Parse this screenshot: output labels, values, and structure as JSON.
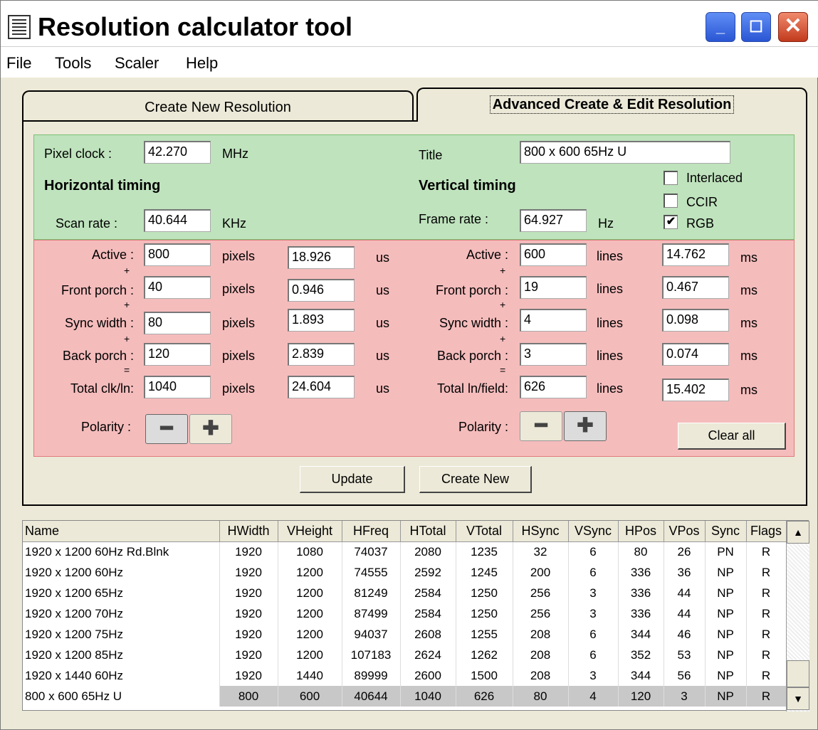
{
  "window": {
    "title": "Resolution calculator tool"
  },
  "titlebar_buttons": {
    "minimize": "_",
    "maximize": "☐",
    "close": "✕"
  },
  "menu": [
    "File",
    "Tools",
    "Scaler",
    "Help"
  ],
  "tabs": [
    {
      "label": "Create New Resolution",
      "active": false
    },
    {
      "label": "Advanced Create & Edit Resolution",
      "active": true
    }
  ],
  "form": {
    "pixel_clock_label": "Pixel clock :",
    "pixel_clock": "42.270",
    "pixel_clock_unit": "MHz",
    "title_label": "Title",
    "title_value": "800 x 600 65Hz        U",
    "horizontal_heading": "Horizontal timing",
    "vertical_heading": "Vertical timing",
    "interlaced_label": "Interlaced",
    "ccir_label": "CCIR",
    "rgb_label": "RGB",
    "interlaced": false,
    "ccir": false,
    "rgb": true,
    "scan_rate_label": "Scan rate :",
    "scan_rate": "40.644",
    "scan_rate_unit": "KHz",
    "frame_rate_label": "Frame rate :",
    "frame_rate": "64.927",
    "frame_rate_unit": "Hz",
    "h_rows": [
      {
        "label": "Active :",
        "px": "800",
        "us": "18.926"
      },
      {
        "label": "Front porch :",
        "px": "40",
        "us": "0.946"
      },
      {
        "label": "Sync width :",
        "px": "80",
        "us": "1.893"
      },
      {
        "label": "Back porch :",
        "px": "120",
        "us": "2.839"
      },
      {
        "label": "Total clk/ln:",
        "px": "1040",
        "us": "24.604"
      }
    ],
    "v_rows": [
      {
        "label": "Active :",
        "lines": "600",
        "ms": "14.762"
      },
      {
        "label": "Front porch :",
        "lines": "19",
        "ms": "0.467"
      },
      {
        "label": "Sync width :",
        "lines": "4",
        "ms": "0.098"
      },
      {
        "label": "Back porch :",
        "lines": "3",
        "ms": "0.074"
      },
      {
        "label": "Total ln/field:",
        "lines": "626",
        "ms": "15.402"
      }
    ],
    "ops": [
      "+",
      "+",
      "+",
      "="
    ],
    "px_unit": "pixels",
    "us_unit": "us",
    "lines_unit": "lines",
    "ms_unit": "ms",
    "polarity_label": "Polarity :",
    "h_polarity": "minus",
    "v_polarity": "plus",
    "clear_all": "Clear all",
    "update": "Update",
    "create_new": "Create New"
  },
  "table": {
    "columns": [
      "Name",
      "HWidth",
      "VHeight",
      "HFreq",
      "HTotal",
      "VTotal",
      "HSync",
      "VSync",
      "HPos",
      "VPos",
      "Sync",
      "Flags"
    ],
    "rows": [
      [
        "1920 x 1200 60Hz Rd.Blnk",
        "1920",
        "1080",
        "74037",
        "2080",
        "1235",
        "32",
        "6",
        "80",
        "26",
        "PN",
        "R"
      ],
      [
        "1920 x 1200 60Hz",
        "1920",
        "1200",
        "74555",
        "2592",
        "1245",
        "200",
        "6",
        "336",
        "36",
        "NP",
        "R"
      ],
      [
        "1920 x 1200 65Hz",
        "1920",
        "1200",
        "81249",
        "2584",
        "1250",
        "256",
        "3",
        "336",
        "44",
        "NP",
        "R"
      ],
      [
        "1920 x 1200 70Hz",
        "1920",
        "1200",
        "87499",
        "2584",
        "1250",
        "256",
        "3",
        "336",
        "44",
        "NP",
        "R"
      ],
      [
        "1920 x 1200 75Hz",
        "1920",
        "1200",
        "94037",
        "2608",
        "1255",
        "208",
        "6",
        "344",
        "46",
        "NP",
        "R"
      ],
      [
        "1920 x 1200 85Hz",
        "1920",
        "1200",
        "107183",
        "2624",
        "1262",
        "208",
        "6",
        "352",
        "53",
        "NP",
        "R"
      ],
      [
        "1920 x 1440 60Hz",
        "1920",
        "1440",
        "89999",
        "2600",
        "1500",
        "208",
        "3",
        "344",
        "56",
        "NP",
        "R"
      ],
      [
        "800 x 600 65Hz        U",
        "800",
        "600",
        "40644",
        "1040",
        "626",
        "80",
        "4",
        "120",
        "3",
        "NP",
        "R"
      ]
    ],
    "selected_row": 7
  }
}
